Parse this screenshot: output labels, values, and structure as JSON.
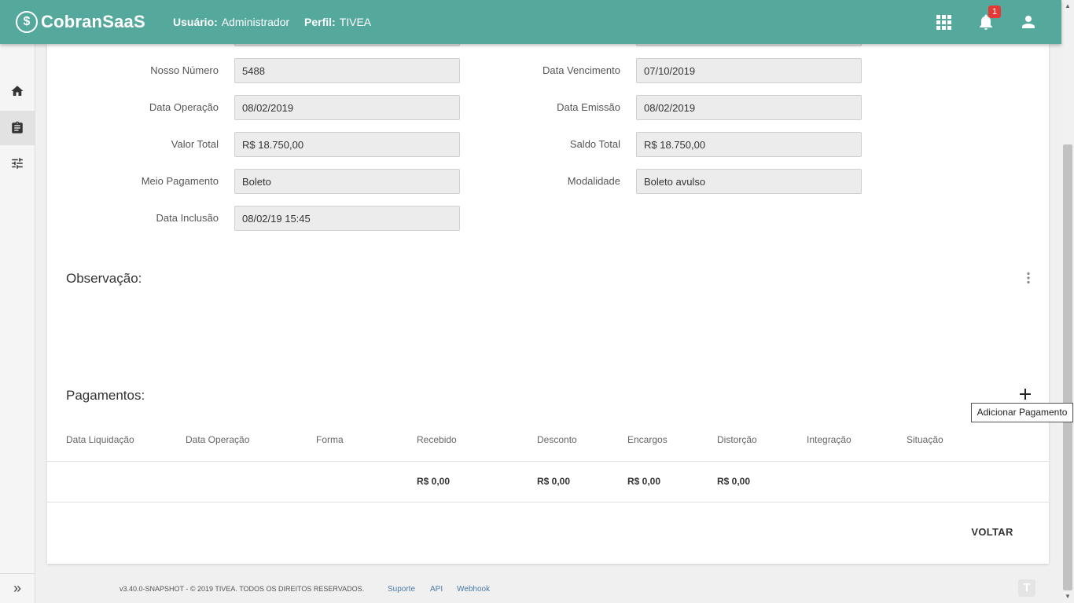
{
  "header": {
    "logo_text": "CobranSaaS",
    "user_label": "Usuário:",
    "user_value": "Administrador",
    "profile_label": "Perfil:",
    "profile_value": "TIVEA",
    "notification_count": "1",
    "icons": [
      "apps-icon",
      "bell-icon",
      "person-icon"
    ]
  },
  "sidebar": {
    "items": [
      "home-icon",
      "clipboard-icon",
      "tune-icon"
    ],
    "active_item": "clipboard-icon",
    "expand_label": "»"
  },
  "fields": {
    "nosso_numero": {
      "label": "Nosso Número",
      "value": "5488"
    },
    "data_vencimento": {
      "label": "Data Vencimento",
      "value": "07/10/2019"
    },
    "data_operacao": {
      "label": "Data Operação",
      "value": "08/02/2019"
    },
    "data_emissao": {
      "label": "Data Emissão",
      "value": "08/02/2019"
    },
    "valor_total": {
      "label": "Valor Total",
      "value": "R$ 18.750,00"
    },
    "saldo_total": {
      "label": "Saldo Total",
      "value": "R$ 18.750,00"
    },
    "meio_pagamento": {
      "label": "Meio Pagamento",
      "value": "Boleto"
    },
    "modalidade": {
      "label": "Modalidade",
      "value": "Boleto avulso"
    },
    "data_inclusao": {
      "label": "Data Inclusão",
      "value": "08/02/19 15:45"
    }
  },
  "observacao": {
    "title": "Observação:"
  },
  "pagamentos": {
    "title": "Pagamentos:",
    "add_tooltip": "Adicionar Pagamento",
    "columns": [
      "Data Liquidação",
      "Data Operação",
      "Forma",
      "Recebido",
      "Desconto",
      "Encargos",
      "Distorção",
      "Integração",
      "Situação"
    ],
    "totals": {
      "recebido": "R$ 0,00",
      "desconto": "R$ 0,00",
      "encargos": "R$ 0,00",
      "distorcao": "R$ 0,00"
    }
  },
  "actions": {
    "back_label": "VOLTAR"
  },
  "footer": {
    "copyright": "v3.40.0-SNAPSHOT - © 2019 TIVEA. TODOS OS DIREITOS RESERVADOS.",
    "links": [
      "Suporte",
      "API",
      "Webhook"
    ],
    "logo_glyph": "T"
  },
  "colors": {
    "header": "#55a89c",
    "badge": "#e53935",
    "link": "#4a7aa8"
  }
}
